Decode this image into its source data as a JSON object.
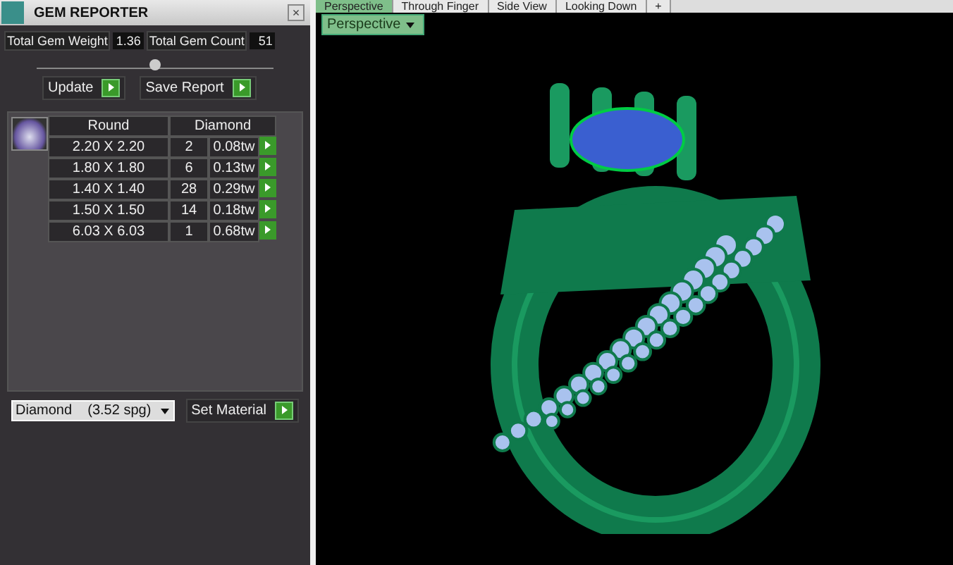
{
  "panel": {
    "title": "GEM REPORTER",
    "close": "×"
  },
  "totals": [
    {
      "label": "Total Gem Weight",
      "value": "1.36"
    },
    {
      "label": "Total Gem Count",
      "value": "51"
    }
  ],
  "actions": [
    {
      "label": "Update"
    },
    {
      "label": "Save Report"
    }
  ],
  "table": {
    "columns": [
      "Round",
      "Diamond"
    ],
    "rows": [
      {
        "size": "2.20 X 2.20",
        "count": "2",
        "weight": "0.08tw"
      },
      {
        "size": "1.80 X 1.80",
        "count": "6",
        "weight": "0.13tw"
      },
      {
        "size": "1.40 X 1.40",
        "count": "28",
        "weight": "0.29tw"
      },
      {
        "size": "1.50 X 1.50",
        "count": "14",
        "weight": "0.18tw"
      },
      {
        "size": "6.03 X 6.03",
        "count": "1",
        "weight": "0.68tw"
      }
    ]
  },
  "material": {
    "value": "Diamond    (3.52 spg)",
    "button": "Set Material"
  },
  "viewport": {
    "tabs": [
      {
        "label": "Perspective",
        "selected": true
      },
      {
        "label": "Through Finger",
        "selected": false
      },
      {
        "label": "Side View",
        "selected": false
      },
      {
        "label": "Looking Down",
        "selected": false
      },
      {
        "label": "+",
        "selected": false
      }
    ],
    "view_menu": "Perspective"
  }
}
